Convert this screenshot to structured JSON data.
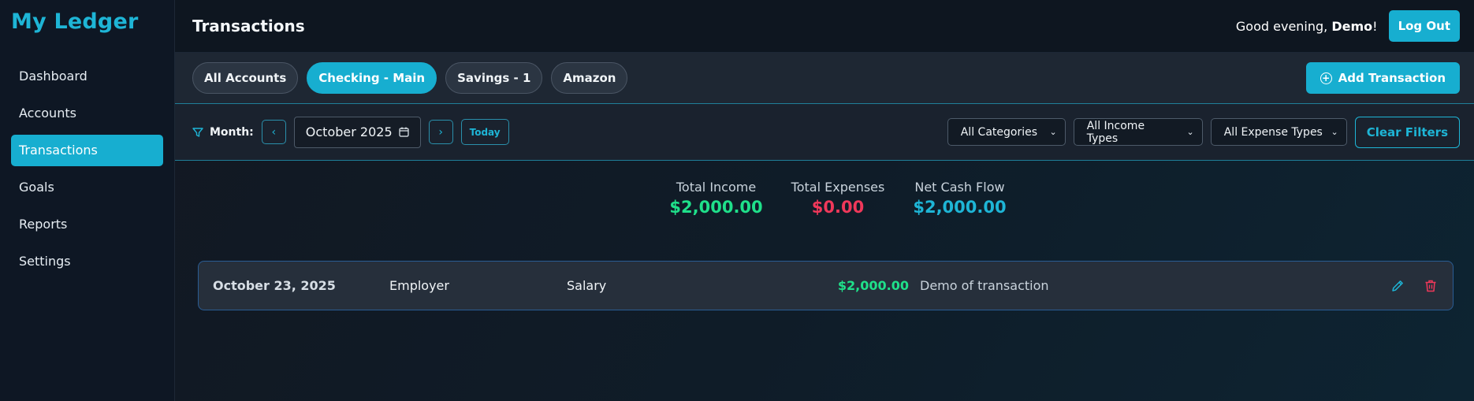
{
  "app": {
    "brand": "My Ledger"
  },
  "sidebar": {
    "items": [
      {
        "label": "Dashboard"
      },
      {
        "label": "Accounts"
      },
      {
        "label": "Transactions",
        "active": true
      },
      {
        "label": "Goals"
      },
      {
        "label": "Reports"
      },
      {
        "label": "Settings"
      }
    ]
  },
  "header": {
    "title": "Transactions",
    "greeting_prefix": "Good evening,",
    "username": "Demo",
    "greeting_suffix": "!",
    "logout_label": "Log Out"
  },
  "account_tabs": [
    {
      "label": "All Accounts"
    },
    {
      "label": "Checking - Main",
      "active": true
    },
    {
      "label": "Savings - 1"
    },
    {
      "label": "Amazon"
    }
  ],
  "actions": {
    "add_transaction_label": "Add Transaction"
  },
  "filters": {
    "month_label": "Month:",
    "prev_arrow": "‹",
    "next_arrow": "›",
    "month_value": "October 2025",
    "today_label": "Today",
    "category_select": "All Categories",
    "income_type_select": "All Income Types",
    "expense_type_select": "All Expense Types",
    "clear_label": "Clear Filters"
  },
  "summary": {
    "income_label": "Total Income",
    "income_value": "$2,000.00",
    "expenses_label": "Total Expenses",
    "expenses_value": "$0.00",
    "net_label": "Net Cash Flow",
    "net_value": "$2,000.00"
  },
  "transactions": [
    {
      "date": "October 23, 2025",
      "payee": "Employer",
      "category": "Salary",
      "amount": "$2,000.00",
      "description": "Demo of transaction"
    }
  ],
  "colors": {
    "accent": "#17aed0",
    "income": "#1fe08a",
    "expense": "#f0385a"
  },
  "icons": [
    "filter-icon",
    "calendar-icon",
    "chevron-left-icon",
    "chevron-right-icon",
    "plus-circle-icon",
    "edit-icon",
    "trash-icon"
  ]
}
